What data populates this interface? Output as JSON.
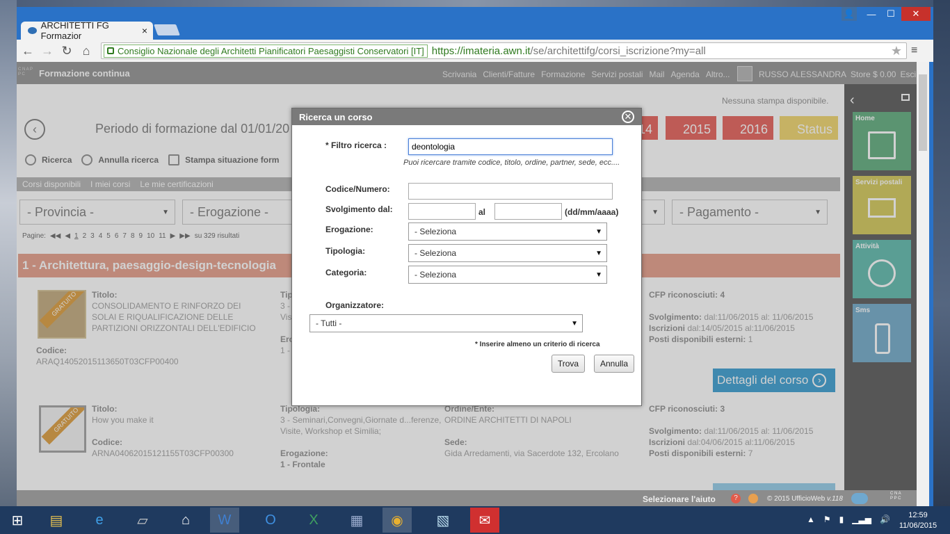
{
  "browser": {
    "tab_title": "ARCHITETTI FG Formazior",
    "tab_close": "×",
    "ev_cert": "Consiglio Nazionale degli Architetti Pianificatori Paesaggisti Conservatori [IT]",
    "url_host": "https://imateria.awn.it",
    "url_path": "/se/architettifg/corsi_iscrizione?my=all",
    "nav": {
      "back": "←",
      "forward": "→",
      "reload": "↻",
      "home": "⌂",
      "star": "★",
      "menu": "≡"
    },
    "window": {
      "user": "👤",
      "minimize": "—",
      "maximize": "☐",
      "close": "✕"
    }
  },
  "app": {
    "logo": "C N A P P C",
    "title": "Formazione continua",
    "nav": [
      "Scrivania",
      "Clienti/Fatture",
      "Formazione",
      "Servizi postali",
      "Mail",
      "Agenda",
      "Altro..."
    ],
    "user": "RUSSO ALESSANDRA",
    "store": "Store $ 0.00",
    "exit": "Esci",
    "period": "Periodo di formazione dal 01/01/20",
    "no_print": "Nessuna stampa disponibile.",
    "year_buttons": [
      "14",
      "2015",
      "2016",
      "Status"
    ],
    "actions": [
      "Ricerca",
      "Annulla ricerca",
      "Stampa situazione form"
    ],
    "filter_tabs": [
      "Corsi disponibili",
      "I miei corsi",
      "Le mie certificazioni"
    ],
    "selects": [
      "- Provincia -",
      "- Erogazione -",
      "- Pagamento -"
    ],
    "pagination": {
      "label": "Pagine:",
      "pages": [
        "1",
        "2",
        "3",
        "4",
        "5",
        "6",
        "7",
        "8",
        "9",
        "10",
        "11"
      ],
      "results": "su 329 risultati"
    },
    "section": "1 - Architettura, paesaggio-design-tecnologia",
    "courses": [
      {
        "badge": "GRATUITO",
        "title_label": "Titolo:",
        "title": "CONSOLIDAMENTO E RINFORZO DEI SOLAI E RIQUALIFICAZIONE DELLE PARTIZIONI ORIZZONTALI DELL'EDIFICIO",
        "code_label": "Codice:",
        "code": "ARAQ14052015113650T03CFP00400",
        "tip_label": "Tip",
        "tip": "3 -",
        "vis": "Visi",
        "ero_label": "Ero",
        "ero": "1 -",
        "cfp": "CFP riconosciuti: 4",
        "svolg_label": "Svolgimento:",
        "svolg": "dal:11/06/2015 al: 11/06/2015",
        "iscr_label": "Iscrizioni",
        "iscr": "dal:14/05/2015 al:11/06/2015",
        "posti_label": "Posti disponibili esterni:",
        "posti": "1"
      },
      {
        "badge": "GRATUITO",
        "title_label": "Titolo:",
        "title": "How you make it",
        "code_label": "Codice:",
        "code": "ARNA04062015121155T03CFP00300",
        "tip_label": "Tipologia:",
        "tip": "3 - Seminari,Convegni,Giornate d...ferenze, Visite, Workshop et Similia;",
        "ero_label": "Erogazione:",
        "ero": "1 - Frontale",
        "ente_label": "Ordine/Ente:",
        "ente": "ORDINE ARCHITETTI DI NAPOLI",
        "sede_label": "Sede:",
        "sede": "Gida Arredamenti, via Sacerdote 132, Ercolano",
        "cfp": "CFP riconosciuti: 3",
        "svolg_label": "Svolgimento:",
        "svolg": "dal:11/06/2015 al: 11/06/2015",
        "iscr_label": "Iscrizioni",
        "iscr": "dal:04/06/2015 al:11/06/2015",
        "posti_label": "Posti disponibili esterni:",
        "posti": "7"
      }
    ],
    "details_button": "Dettagli del corso",
    "tiles": [
      {
        "label": "Home",
        "color": "#6fb58a"
      },
      {
        "label": "Servizi postali",
        "color": "#d8cf6a"
      },
      {
        "label": "Attività",
        "color": "#6ec1b5"
      },
      {
        "label": "Sms",
        "color": "#7fb2cf"
      }
    ],
    "status_help": "Selezionare l'aiuto",
    "status_help_icon": "?",
    "copyright": "© 2015 UfficioWeb",
    "version": "v.118"
  },
  "dialog": {
    "title": "Ricerca un corso",
    "close": "✕",
    "filter_label": "* Filtro ricerca :",
    "filter_value": "deontologia",
    "filter_hint": "Puoi ricercare tramite codice, titolo, ordine, partner, sede, ecc....",
    "code_label": "Codice/Numero:",
    "date_label": "Svolgimento dal:",
    "date_al": "al",
    "date_format": "(dd/mm/aaaa)",
    "erogazione_label": "Erogazione:",
    "tipologia_label": "Tipologia:",
    "categoria_label": "Categoria:",
    "select_default": "- Seleziona",
    "organizzatore_label": "Organizzatore:",
    "organizzatore_value": "- Tutti -",
    "note": "* Inserire almeno un criterio di ricerca",
    "search_button": "Trova",
    "cancel_button": "Annulla"
  },
  "taskbar": {
    "time": "12:59",
    "date": "11/06/2015"
  }
}
